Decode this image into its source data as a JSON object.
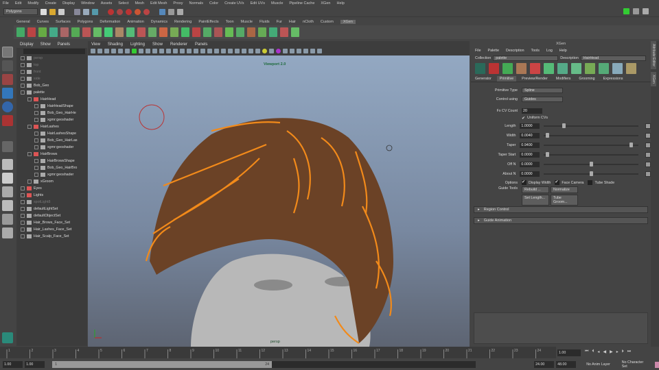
{
  "menubar": [
    "File",
    "Edit",
    "Modify",
    "Create",
    "Display",
    "Window",
    "Assets",
    "Select",
    "Mesh",
    "Edit Mesh",
    "Proxy",
    "Normals",
    "Color",
    "Create UVs",
    "Edit UVs",
    "Muscle",
    "Pipeline Cache",
    "XGen",
    "Help"
  ],
  "status": {
    "mode": "Polygons"
  },
  "shelf_tabs": [
    "General",
    "Curves",
    "Surfaces",
    "Polygons",
    "Deformation",
    "Animation",
    "Dynamics",
    "Rendering",
    "PaintEffects",
    "Toon",
    "Muscle",
    "Fluids",
    "Fur",
    "Hair",
    "nCloth",
    "Custom",
    "XGen"
  ],
  "shelf_active": "XGen",
  "outliner": {
    "menu": [
      "Display",
      "Show",
      "Panels"
    ],
    "items": [
      {
        "label": "persp",
        "depth": 0,
        "dim": true
      },
      {
        "label": "top",
        "depth": 0,
        "dim": true
      },
      {
        "label": "front",
        "depth": 0,
        "dim": true
      },
      {
        "label": "side",
        "depth": 0,
        "dim": true
      },
      {
        "label": "Bob_Geo",
        "depth": 0
      },
      {
        "label": "palette",
        "depth": 0
      },
      {
        "label": "HairHead",
        "depth": 1
      },
      {
        "label": "HairHeadShape",
        "depth": 2
      },
      {
        "label": "Bob_Geo_HairHe",
        "depth": 2
      },
      {
        "label": "xgmr:geoshader",
        "depth": 2
      },
      {
        "label": "HairLashes",
        "depth": 1
      },
      {
        "label": "HairLashesShape",
        "depth": 2
      },
      {
        "label": "Bob_Geo_HairLas",
        "depth": 2
      },
      {
        "label": "xgmr:geoshader",
        "depth": 2
      },
      {
        "label": "HairBrows",
        "depth": 1
      },
      {
        "label": "HairBrowsShape",
        "depth": 2
      },
      {
        "label": "Bob_Geo_HairBro",
        "depth": 2
      },
      {
        "label": "xgmr:geoshader",
        "depth": 2
      },
      {
        "label": "xGroom",
        "depth": 1
      },
      {
        "label": "Eyes",
        "depth": 0
      },
      {
        "label": "Lights",
        "depth": 0
      },
      {
        "label": "spotLight8",
        "depth": 0,
        "dim": true
      },
      {
        "label": "defaultLightSet",
        "depth": 0
      },
      {
        "label": "defaultObjectSet",
        "depth": 0
      },
      {
        "label": "Hair_Brows_Face_Set",
        "depth": 0
      },
      {
        "label": "Hair_Lashes_Face_Set",
        "depth": 0
      },
      {
        "label": "Hair_Scalp_Face_Set",
        "depth": 0
      }
    ]
  },
  "viewport": {
    "menu": [
      "View",
      "Shading",
      "Lighting",
      "Show",
      "Renderer",
      "Panels"
    ],
    "renderer_label": "Viewport 2.0",
    "camera": "persp"
  },
  "xgen": {
    "title": "XGen",
    "menu": [
      "File",
      "Palette",
      "Description",
      "Tools",
      "Log",
      "Help"
    ],
    "collection_label": "Collection",
    "collection": "palette",
    "description_label": "Description",
    "description": "HairHead",
    "tabs": [
      "Generator",
      "Primitive",
      "Preview/Render",
      "Modifiers",
      "Grooming",
      "Expressions"
    ],
    "active_tab": "Primitive",
    "primitive_type_label": "Primitive Type",
    "primitive_type": "Spline",
    "control_label": "Control using",
    "control": "Guides",
    "cv_count_label": "Fx CV Count",
    "cv_count": "20",
    "uniform_cvs": "Uniform CVs",
    "params": [
      {
        "label": "Length",
        "value": "1.0000",
        "slider": 0.2
      },
      {
        "label": "Width",
        "value": "0.0040",
        "slider": 0.02
      },
      {
        "label": "Taper",
        "value": "0.9400",
        "slider": 0.94
      },
      {
        "label": "Taper Start",
        "value": "0.0000",
        "slider": 0.02
      },
      {
        "label": "Off N",
        "value": "0.0000",
        "slider": 0.5
      },
      {
        "label": "About N",
        "value": "0.0000",
        "slider": 0.5
      }
    ],
    "options_label": "Options",
    "options": [
      {
        "label": "Display Width",
        "checked": true
      },
      {
        "label": "Face Camera",
        "checked": true
      },
      {
        "label": "Tube Shade",
        "checked": false
      }
    ],
    "guide_tools_label": "Guide Tools",
    "guide_tools": [
      "Rebuild ...",
      "Normalize",
      "Set Length...",
      "Tube Groom..."
    ],
    "sections": [
      "Region Control",
      "Guide Animation"
    ]
  },
  "side_tabs": [
    "Attribute Editor",
    "XGen"
  ],
  "timeline": {
    "ticks": [
      "1",
      "2",
      "3",
      "4",
      "5",
      "6",
      "7",
      "8",
      "9",
      "10",
      "11",
      "12",
      "13",
      "14",
      "15",
      "16",
      "17",
      "18",
      "19",
      "20",
      "21",
      "22",
      "23",
      "24"
    ],
    "current": "1.00"
  },
  "range": {
    "start": "1.00",
    "start2": "1.00",
    "slider_start": "1",
    "slider_end": "24",
    "end": "24.00",
    "end2": "48.00",
    "anim_layer": "No Anim Layer",
    "char_set": "No Character Set"
  }
}
